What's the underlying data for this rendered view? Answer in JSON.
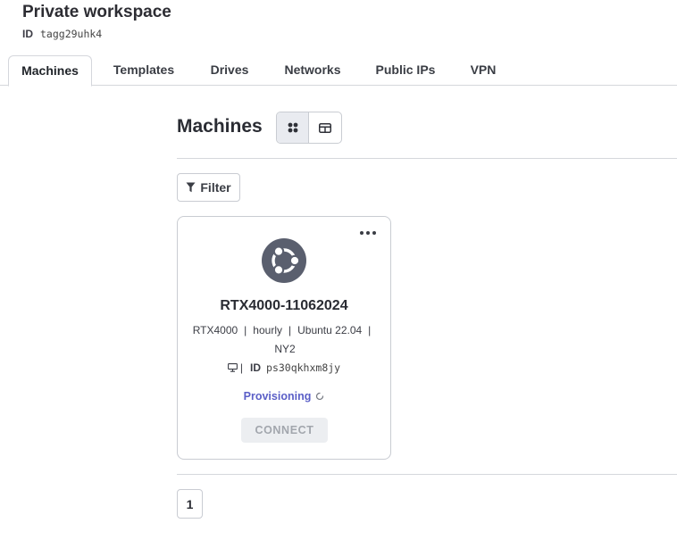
{
  "workspace": {
    "title": "Private workspace",
    "id_label": "ID",
    "id_value": "tagg29uhk4"
  },
  "tabs": [
    {
      "label": "Machines",
      "active": true
    },
    {
      "label": "Templates",
      "active": false
    },
    {
      "label": "Drives",
      "active": false
    },
    {
      "label": "Networks",
      "active": false
    },
    {
      "label": "Public IPs",
      "active": false
    },
    {
      "label": "VPN",
      "active": false
    }
  ],
  "section": {
    "title": "Machines",
    "view_mode": "grid",
    "view_options": [
      "grid-icon",
      "table-icon"
    ]
  },
  "filter": {
    "label": "Filter",
    "icon": "filter-icon"
  },
  "machines": [
    {
      "name": "RTX4000-11062024",
      "os_icon": "ubuntu-icon",
      "gpu": "RTX4000",
      "billing": "hourly",
      "os": "Ubuntu 22.04",
      "region": "NY2",
      "id_label": "ID",
      "id_value": "ps30qkhxm8jy",
      "status": "Provisioning",
      "connect_label": "CONNECT",
      "connect_enabled": false
    }
  ],
  "pagination": {
    "current_page": "1"
  },
  "colors": {
    "status_provisioning": "#5b5fc7",
    "border": "#c9ccd2",
    "text": "#2a2c33"
  }
}
